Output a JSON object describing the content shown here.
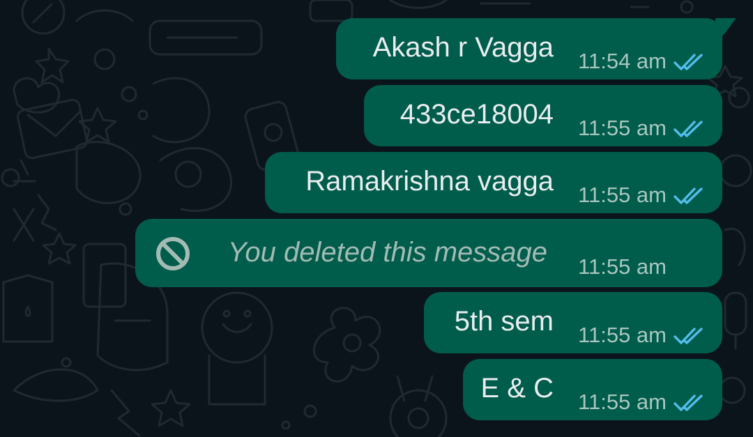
{
  "colors": {
    "background": "#0b141a",
    "bubble_outgoing": "#005c4b",
    "message_text": "#e9edef",
    "timestamp_text": "#a9c7bf",
    "deleted_text": "#a4bbb4",
    "read_ticks": "#53bdeb"
  },
  "messages": [
    {
      "text": "Akash r Vagga",
      "time": "11:54 am",
      "status_icon": "double-check-read-icon"
    },
    {
      "text": "433ce18004",
      "time": "11:55 am",
      "status_icon": "double-check-read-icon"
    },
    {
      "text": "Ramakrishna vagga",
      "time": "11:55 am",
      "status_icon": "double-check-read-icon"
    },
    {
      "text": "You deleted this message",
      "time": "11:55 am",
      "deleted": true,
      "icon": "ban-icon"
    },
    {
      "text": "5th sem",
      "time": "11:55 am",
      "status_icon": "double-check-read-icon"
    },
    {
      "text": "E & C",
      "time": "11:55 am",
      "status_icon": "double-check-read-icon"
    }
  ]
}
